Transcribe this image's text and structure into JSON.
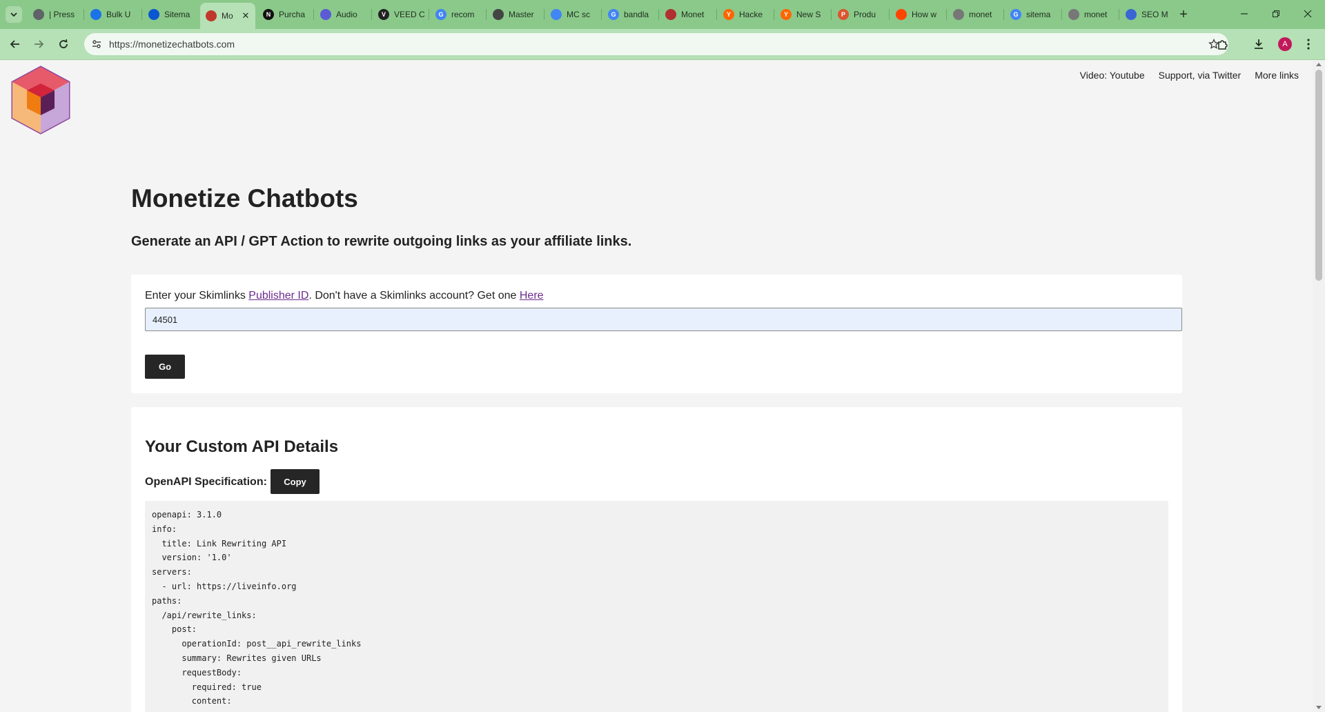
{
  "browser": {
    "tabs": [
      {
        "label": "| Press",
        "fav_color": "#5f6368",
        "fav_char": ""
      },
      {
        "label": "Bulk U",
        "fav_color": "#1a73e8",
        "fav_char": ""
      },
      {
        "label": "Sitema",
        "fav_color": "#0b57d0",
        "fav_char": ""
      },
      {
        "label": "Mo",
        "fav_color": "#c0392b",
        "fav_char": "",
        "active": true
      },
      {
        "label": "Purcha",
        "fav_color": "#111111",
        "fav_char": "N"
      },
      {
        "label": "Audio",
        "fav_color": "#5b5bd6",
        "fav_char": ""
      },
      {
        "label": "VEED C",
        "fav_color": "#222222",
        "fav_char": "V"
      },
      {
        "label": "recom",
        "fav_color": "#4285f4",
        "fav_char": "G"
      },
      {
        "label": "Master",
        "fav_color": "#444444",
        "fav_char": ""
      },
      {
        "label": "MC sc",
        "fav_color": "#4285f4",
        "fav_char": ""
      },
      {
        "label": "bandla",
        "fav_color": "#4285f4",
        "fav_char": "G"
      },
      {
        "label": "Monet",
        "fav_color": "#b03030",
        "fav_char": ""
      },
      {
        "label": "Hacke",
        "fav_color": "#ff6600",
        "fav_char": "Y"
      },
      {
        "label": "New S",
        "fav_color": "#ff6600",
        "fav_char": "Y"
      },
      {
        "label": "Produ",
        "fav_color": "#da552f",
        "fav_char": "P"
      },
      {
        "label": "How w",
        "fav_color": "#ff4500",
        "fav_char": ""
      },
      {
        "label": "monet",
        "fav_color": "#777777",
        "fav_char": ""
      },
      {
        "label": "sitema",
        "fav_color": "#4285f4",
        "fav_char": "G"
      },
      {
        "label": "monet",
        "fav_color": "#777777",
        "fav_char": ""
      },
      {
        "label": "SEO M",
        "fav_color": "#3a66d4",
        "fav_char": ""
      }
    ],
    "url": "https://monetizechatbots.com",
    "avatar_letter": "A"
  },
  "header": {
    "links": [
      "Video: Youtube",
      "Support, via Twitter",
      "More links"
    ]
  },
  "main": {
    "title": "Monetize Chatbots",
    "subtitle": "Generate an API / GPT Action to rewrite outgoing links as your affiliate links.",
    "form": {
      "prompt_text_1": "Enter your Skimlinks ",
      "publisher_link": "Publisher ID",
      "prompt_text_2": ". Don't have a Skimlinks account? Get one ",
      "here_link": "Here",
      "input_value": "44501",
      "go_label": "Go"
    },
    "api": {
      "heading": "Your Custom API Details",
      "spec_label": "OpenAPI Specification:",
      "copy_label": "Copy",
      "code_lines": [
        "openapi: 3.1.0",
        "info:",
        "  title: Link Rewriting API",
        "  version: '1.0'",
        "servers:",
        "  - url: https://liveinfo.org",
        "paths:",
        "  /api/rewrite_links:",
        "    post:",
        "      operationId: post__api_rewrite_links",
        "      summary: Rewrites given URLs",
        "      requestBody:",
        "        required: true",
        "        content:"
      ]
    }
  },
  "colors": {
    "tabbar": "#8ac98a",
    "toolbar": "#b6e0b6",
    "button_dark": "#262626",
    "link": "#6a2b8e"
  },
  "icons": {
    "tab_list": "chevron-down-icon",
    "back": "back-arrow-icon",
    "forward": "forward-arrow-icon",
    "reload": "reload-icon",
    "site_info": "site-info-icon",
    "bookmark": "star-icon",
    "extensions": "puzzle-icon",
    "downloads": "download-icon",
    "menu": "kebab-menu-icon"
  }
}
